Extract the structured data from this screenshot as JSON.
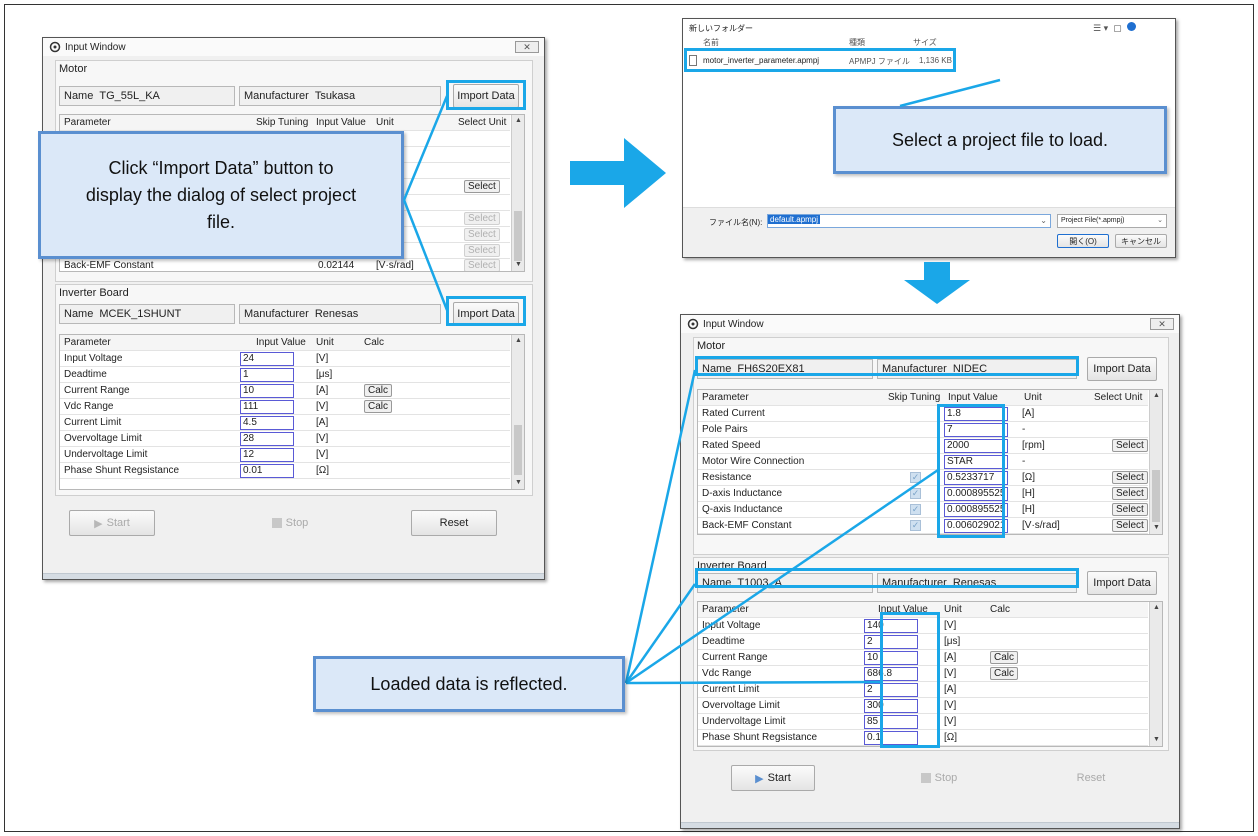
{
  "left_window": {
    "title": "Input Window",
    "close": "✕",
    "motor": {
      "section_title": "Motor",
      "name_label": "Name",
      "name_value": "TG_55L_KA",
      "manufacturer_label": "Manufacturer",
      "manufacturer_value": "Tsukasa",
      "import_button": "Import Data",
      "columns": [
        "Parameter",
        "Skip Tuning",
        "Input Value",
        "Unit",
        "Select Unit"
      ],
      "select_labels": [
        "Select",
        "Select",
        "Select",
        "Select",
        "Select"
      ],
      "last_row_parameter": "Back-EMF Constant",
      "last_row_value": "0.02144",
      "last_row_unit": "[V·s/rad]"
    },
    "inverter": {
      "section_title": "Inverter Board",
      "name_label": "Name",
      "name_value": "MCEK_1SHUNT",
      "manufacturer_label": "Manufacturer",
      "manufacturer_value": "Renesas",
      "import_button": "Import Data",
      "columns": [
        "Parameter",
        "Input Value",
        "Unit",
        "Calc"
      ],
      "rows": [
        {
          "param": "Input Voltage",
          "value": "24",
          "unit": "[V]",
          "calc": ""
        },
        {
          "param": "Deadtime",
          "value": "1",
          "unit": "[μs]",
          "calc": ""
        },
        {
          "param": "Current Range",
          "value": "10",
          "unit": "[A]",
          "calc": "Calc"
        },
        {
          "param": "Vdc Range",
          "value": "111",
          "unit": "[V]",
          "calc": "Calc"
        },
        {
          "param": "Current Limit",
          "value": "4.5",
          "unit": "[A]",
          "calc": ""
        },
        {
          "param": "Overvoltage Limit",
          "value": "28",
          "unit": "[V]",
          "calc": ""
        },
        {
          "param": "Undervoltage Limit",
          "value": "12",
          "unit": "[V]",
          "calc": ""
        },
        {
          "param": "Phase Shunt Regsistance",
          "value": "0.01",
          "unit": "[Ω]",
          "calc": ""
        }
      ]
    },
    "buttons": {
      "start": "Start",
      "stop": "Stop",
      "reset": "Reset"
    }
  },
  "callouts": {
    "import_hint": "Click “Import Data” button to display the dialog of select project file.",
    "select_file": "Select a project file to load.",
    "loaded": "Loaded data is reflected."
  },
  "file_dialog": {
    "breadcrumb": "新しいフォルダー",
    "columns": [
      "名前",
      "種類",
      "サイズ"
    ],
    "file_name": "motor_inverter_parameter.apmpj",
    "file_type": "APMPJ ファイル",
    "file_size": "1,136 KB",
    "filename_label": "ファイル名(N):",
    "filename_value": "default.apmpj",
    "filter": "Project File(*.apmpj)",
    "open_button": "開く(O)",
    "cancel_button": "キャンセル"
  },
  "right_window": {
    "title": "Input Window",
    "close": "✕",
    "motor": {
      "section_title": "Motor",
      "name_label": "Name",
      "name_value": "FH6S20EX81",
      "manufacturer_label": "Manufacturer",
      "manufacturer_value": "NIDEC",
      "import_button": "Import Data",
      "columns": [
        "Parameter",
        "Skip Tuning",
        "Input Value",
        "Unit",
        "Select Unit"
      ],
      "rows": [
        {
          "param": "Rated Current",
          "value": "1.8",
          "unit": "[A]",
          "skip": false,
          "select": ""
        },
        {
          "param": "Pole Pairs",
          "value": "7",
          "unit": "-",
          "skip": false,
          "select": ""
        },
        {
          "param": "Rated Speed",
          "value": "2000",
          "unit": "[rpm]",
          "skip": false,
          "select": "Select"
        },
        {
          "param": "Motor Wire Connection",
          "value": "STAR",
          "unit": "-",
          "skip": false,
          "select": ""
        },
        {
          "param": "Resistance",
          "value": "0.5233717",
          "unit": "[Ω]",
          "skip": true,
          "select": "Select"
        },
        {
          "param": "D-axis Inductance",
          "value": "0.000895525",
          "unit": "[H]",
          "skip": true,
          "select": "Select"
        },
        {
          "param": "Q-axis Inductance",
          "value": "0.000895525",
          "unit": "[H]",
          "skip": true,
          "select": "Select"
        },
        {
          "param": "Back-EMF Constant",
          "value": "0.006029021",
          "unit": "[V·s/rad]",
          "skip": true,
          "select": "Select"
        }
      ]
    },
    "inverter": {
      "section_title": "Inverter Board",
      "name_label": "Name",
      "name_value": "T1003_A",
      "manufacturer_label": "Manufacturer",
      "manufacturer_value": "Renesas",
      "import_button": "Import Data",
      "columns": [
        "Parameter",
        "Input Value",
        "Unit",
        "Calc"
      ],
      "rows": [
        {
          "param": "Input Voltage",
          "value": "140",
          "unit": "[V]",
          "calc": ""
        },
        {
          "param": "Deadtime",
          "value": "2",
          "unit": "[μs]",
          "calc": ""
        },
        {
          "param": "Current Range",
          "value": "10",
          "unit": "[A]",
          "calc": "Calc"
        },
        {
          "param": "Vdc Range",
          "value": "686.8",
          "unit": "[V]",
          "calc": "Calc"
        },
        {
          "param": "Current Limit",
          "value": "2",
          "unit": "[A]",
          "calc": ""
        },
        {
          "param": "Overvoltage Limit",
          "value": "300",
          "unit": "[V]",
          "calc": ""
        },
        {
          "param": "Undervoltage Limit",
          "value": "85",
          "unit": "[V]",
          "calc": ""
        },
        {
          "param": "Phase Shunt Regsistance",
          "value": "0.1",
          "unit": "[Ω]",
          "calc": ""
        }
      ]
    },
    "buttons": {
      "start": "Start",
      "stop": "Stop",
      "reset": "Reset"
    }
  },
  "colors": {
    "highlight": "#1aa7e8",
    "callout_fill": "#dbe8f8",
    "callout_border": "#5a8fd0",
    "value_border": "#5a5ad6"
  }
}
